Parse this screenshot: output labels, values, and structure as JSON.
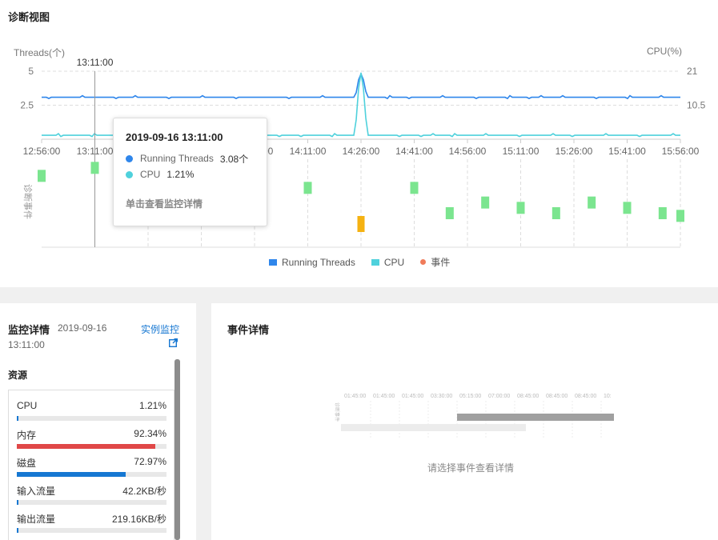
{
  "diagnostics": {
    "title": "诊断视图",
    "left_axis_label": "Threads(个)",
    "right_axis_label": "CPU(%)",
    "crosshair_time": "13:11:00",
    "events_axis_label": "诊断事件",
    "tooltip": {
      "time": "2019-09-16 13:11:00",
      "threads_label": "Running Threads",
      "threads_value": "3.08个",
      "cpu_label": "CPU",
      "cpu_value": "1.21%",
      "link_text": "单击查看监控详情"
    },
    "legend": {
      "threads": "Running Threads",
      "cpu": "CPU",
      "event": "事件"
    }
  },
  "chart_data": {
    "type": "line",
    "x": [
      "12:56:00",
      "13:11:00",
      "13:26:00",
      "13:41:00",
      "13:56:00",
      "14:11:00",
      "14:26:00",
      "14:41:00",
      "14:56:00",
      "15:11:00",
      "15:26:00",
      "15:41:00",
      "15:56:00"
    ],
    "left_ticks": [
      "5",
      "2.5"
    ],
    "right_ticks": [
      "21",
      "10.5"
    ],
    "ylim_left": [
      0,
      5
    ],
    "ylim_right": [
      0,
      21
    ],
    "series": [
      {
        "name": "Running Threads",
        "axis": "left",
        "color": "#2f86eb",
        "baseline": 3.08,
        "peak": {
          "time": "14:26:00",
          "value": 4.8
        }
      },
      {
        "name": "CPU",
        "axis": "right",
        "color": "#4fd1dc",
        "baseline": 1.21,
        "peak": {
          "time": "14:26:00",
          "value": 20.5
        }
      }
    ],
    "events": [
      {
        "time": "12:56:00",
        "level": 1,
        "type": "normal"
      },
      {
        "time": "13:11:00",
        "level": 1,
        "type": "normal"
      },
      {
        "time": "13:56:00",
        "level": 2,
        "type": "normal"
      },
      {
        "time": "14:11:00",
        "level": 2,
        "type": "normal"
      },
      {
        "time": "14:26:00",
        "level": 4,
        "type": "warning"
      },
      {
        "time": "14:41:00",
        "level": 2,
        "type": "normal"
      },
      {
        "time": "14:51:00",
        "level": 3,
        "type": "normal"
      },
      {
        "time": "15:01:00",
        "level": 3,
        "type": "normal"
      },
      {
        "time": "15:11:00",
        "level": 3,
        "type": "normal"
      },
      {
        "time": "15:21:00",
        "level": 3,
        "type": "normal"
      },
      {
        "time": "15:31:00",
        "level": 3,
        "type": "normal"
      },
      {
        "time": "15:41:00",
        "level": 3,
        "type": "normal"
      },
      {
        "time": "15:51:00",
        "level": 3,
        "type": "normal"
      },
      {
        "time": "15:56:00",
        "level": 3,
        "type": "normal"
      }
    ],
    "colors": {
      "normal_event": "#7be58f",
      "warning_event": "#f5b212",
      "event_dot": "#f07b5a"
    }
  },
  "monitor": {
    "title": "监控详情",
    "date": "2019-09-16",
    "time": "13:11:00",
    "instance_link": "实例监控",
    "resources_title": "资源",
    "resources": [
      {
        "label": "CPU",
        "value": "1.21%",
        "percent": 1.21,
        "color": "#1677d2"
      },
      {
        "label": "内存",
        "value": "92.34%",
        "percent": 92.34,
        "color": "#e04848"
      },
      {
        "label": "磁盘",
        "value": "72.97%",
        "percent": 72.97,
        "color": "#1677d2"
      },
      {
        "label": "输入流量",
        "value": "42.2KB/秒",
        "percent": 1,
        "color": "#1677d2"
      },
      {
        "label": "输出流量",
        "value": "219.16KB/秒",
        "percent": 1,
        "color": "#1677d2"
      }
    ]
  },
  "events_panel": {
    "title": "事件详情",
    "hint": "请选择事件查看详情",
    "placeholder_ticks": [
      "01:45:00",
      "01:45:00",
      "01:45:00",
      "03:30:00",
      "05:15:00",
      "07:00:00",
      "08:45:00",
      "08:45:00",
      "08:45:00",
      "10:"
    ],
    "placeholder_axis_label": "诊断事件"
  }
}
